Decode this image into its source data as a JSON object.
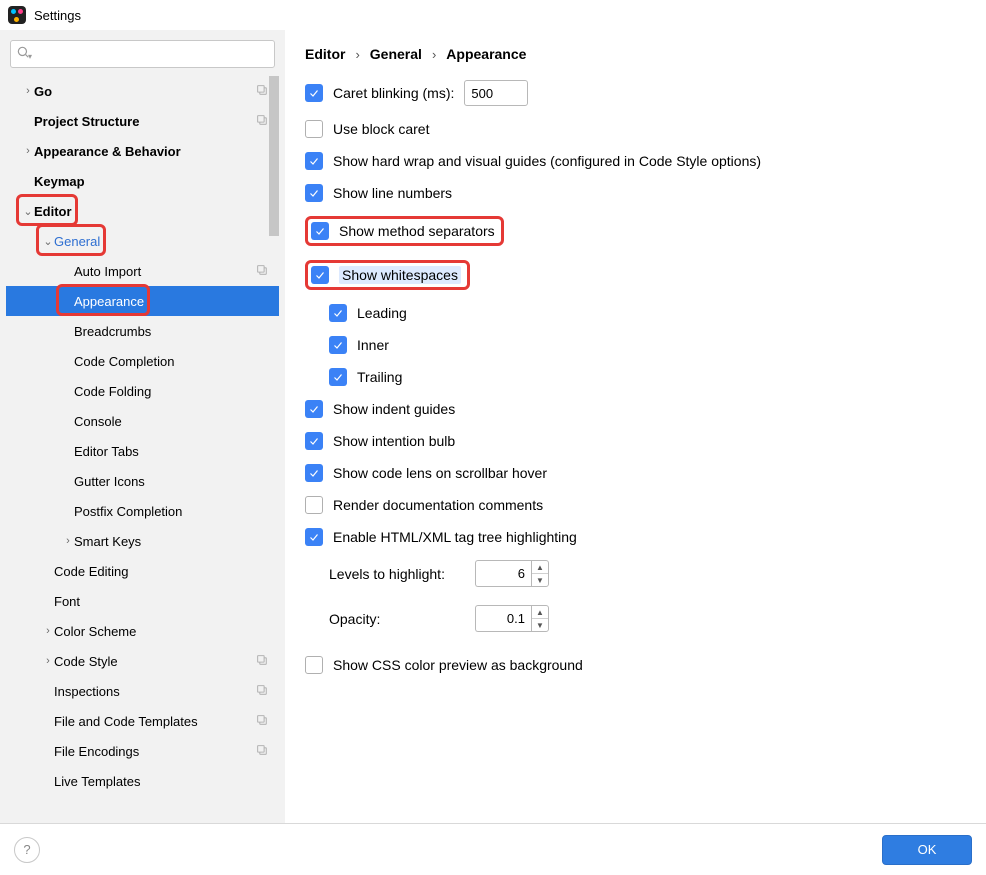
{
  "title": "Settings",
  "search_placeholder": "",
  "sidebar": {
    "items": [
      {
        "label": "Go",
        "depth": 1,
        "caret": "closed",
        "bold": true,
        "badge": true
      },
      {
        "label": "Project Structure",
        "depth": 1,
        "caret": "none",
        "bold": true,
        "badge": true
      },
      {
        "label": "Appearance & Behavior",
        "depth": 1,
        "caret": "closed",
        "bold": true
      },
      {
        "label": "Keymap",
        "depth": 1,
        "caret": "none",
        "bold": true
      },
      {
        "label": "Editor",
        "depth": 1,
        "caret": "open",
        "bold": true,
        "highlight": true
      },
      {
        "label": "General",
        "depth": 2,
        "caret": "open",
        "link": true,
        "highlight": true
      },
      {
        "label": "Auto Import",
        "depth": 3,
        "caret": "none",
        "badge": true
      },
      {
        "label": "Appearance",
        "depth": 3,
        "caret": "none",
        "selected": true,
        "highlight": true
      },
      {
        "label": "Breadcrumbs",
        "depth": 3,
        "caret": "none"
      },
      {
        "label": "Code Completion",
        "depth": 3,
        "caret": "none"
      },
      {
        "label": "Code Folding",
        "depth": 3,
        "caret": "none"
      },
      {
        "label": "Console",
        "depth": 3,
        "caret": "none"
      },
      {
        "label": "Editor Tabs",
        "depth": 3,
        "caret": "none"
      },
      {
        "label": "Gutter Icons",
        "depth": 3,
        "caret": "none"
      },
      {
        "label": "Postfix Completion",
        "depth": 3,
        "caret": "none"
      },
      {
        "label": "Smart Keys",
        "depth": 3,
        "caret": "closed"
      },
      {
        "label": "Code Editing",
        "depth": 2,
        "caret": "none"
      },
      {
        "label": "Font",
        "depth": 2,
        "caret": "none"
      },
      {
        "label": "Color Scheme",
        "depth": 2,
        "caret": "closed"
      },
      {
        "label": "Code Style",
        "depth": 2,
        "caret": "closed",
        "badge": true
      },
      {
        "label": "Inspections",
        "depth": 2,
        "caret": "none",
        "badge": true
      },
      {
        "label": "File and Code Templates",
        "depth": 2,
        "caret": "none",
        "badge": true
      },
      {
        "label": "File Encodings",
        "depth": 2,
        "caret": "none",
        "badge": true
      },
      {
        "label": "Live Templates",
        "depth": 2,
        "caret": "none"
      }
    ]
  },
  "breadcrumb": [
    "Editor",
    "General",
    "Appearance"
  ],
  "options": {
    "caret_blinking": {
      "label": "Caret blinking (ms):",
      "value": "500",
      "checked": true
    },
    "use_block_caret": {
      "label": "Use block caret",
      "checked": false
    },
    "hard_wrap": {
      "label": "Show hard wrap and visual guides (configured in Code Style options)",
      "checked": true
    },
    "line_numbers": {
      "label": "Show line numbers",
      "checked": true
    },
    "method_separators": {
      "label": "Show method separators",
      "checked": true,
      "highlight": true
    },
    "show_whitespaces": {
      "label": "Show whitespaces",
      "checked": true,
      "highlight": true,
      "highlighted_text": true
    },
    "ws_leading": {
      "label": "Leading",
      "checked": true
    },
    "ws_inner": {
      "label": "Inner",
      "checked": true
    },
    "ws_trailing": {
      "label": "Trailing",
      "checked": true
    },
    "indent_guides": {
      "label": "Show indent guides",
      "checked": true
    },
    "intention_bulb": {
      "label": "Show intention bulb",
      "checked": true
    },
    "code_lens": {
      "label": "Show code lens on scrollbar hover",
      "checked": true
    },
    "render_docs": {
      "label": "Render documentation comments",
      "checked": false
    },
    "html_highlight": {
      "label": "Enable HTML/XML tag tree highlighting",
      "checked": true
    },
    "levels": {
      "label": "Levels to highlight:",
      "value": "6"
    },
    "opacity": {
      "label": "Opacity:",
      "value": "0.1"
    },
    "css_preview": {
      "label": "Show CSS color preview as background",
      "checked": false
    }
  },
  "footer": {
    "ok": "OK"
  }
}
